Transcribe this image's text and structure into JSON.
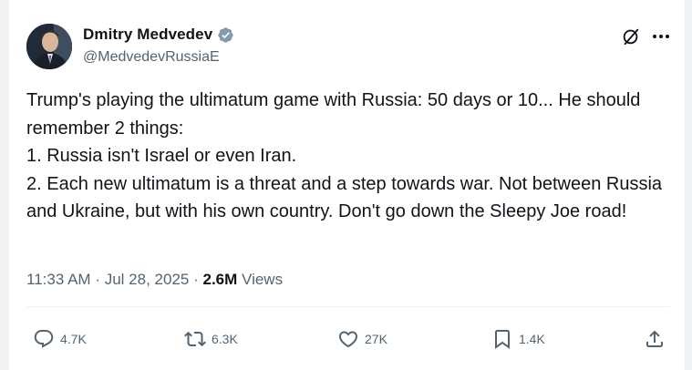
{
  "author": {
    "name": "Dmitry Medvedev",
    "handle": "@MedvedevRussiaE"
  },
  "tweet": {
    "text": "Trump's playing the ultimatum game with Russia: 50 days or 10... He should remember 2 things:\n1. Russia isn't Israel or even Iran.\n2. Each new ultimatum is a threat and a step towards war. Not between Russia and Ukraine, but with his own country. Don't go down the Sleepy Joe road!",
    "time": "11:33 AM",
    "date": "Jul 28, 2025",
    "views_count": "2.6M",
    "views_label": "Views",
    "separator": "·"
  },
  "actions": {
    "replies": "4.7K",
    "reposts": "6.3K",
    "likes": "27K",
    "bookmarks": "1.4K"
  },
  "icons": {
    "verified": "verified-badge-icon",
    "grok": "grok-icon",
    "more": "more-icon",
    "reply": "reply-icon",
    "repost": "repost-icon",
    "like": "heart-icon",
    "bookmark": "bookmark-icon",
    "share": "share-icon"
  },
  "colors": {
    "text": "#0f1419",
    "muted": "#536471",
    "verified_badge": "#829aab"
  }
}
